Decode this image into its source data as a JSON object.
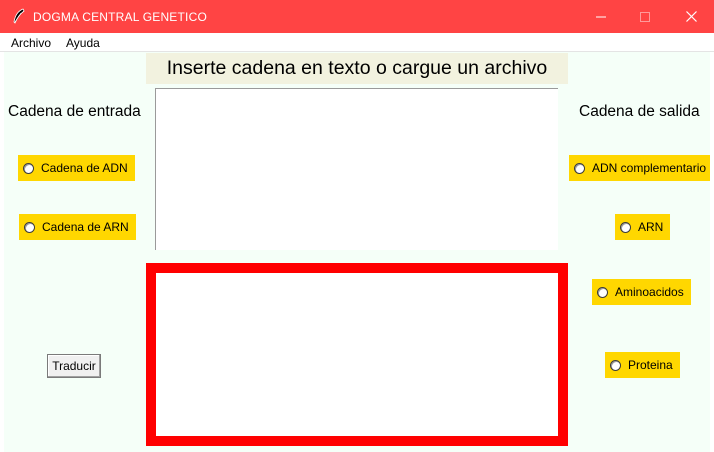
{
  "window": {
    "title": "DOGMA CENTRAL GENETICO",
    "titlebar_color": "#ff4444"
  },
  "menubar": {
    "items": [
      {
        "label": "Archivo"
      },
      {
        "label": "Ayuda"
      }
    ]
  },
  "main": {
    "prompt_label": "Inserte cadena en texto o cargue un archivo",
    "input_section_label": "Cadena de entrada",
    "output_section_label": "Cadena de salida",
    "input_text": "",
    "output_text": "",
    "translate_button_label": "Traducir",
    "input_options": [
      {
        "label": "Cadena de ADN",
        "selected": false
      },
      {
        "label": "Cadena de ARN",
        "selected": false
      }
    ],
    "output_options": [
      {
        "label": "ADN complementario",
        "selected": false
      },
      {
        "label": "ARN",
        "selected": false
      },
      {
        "label": "Aminoacidos",
        "selected": false
      },
      {
        "label": "Proteina",
        "selected": false
      }
    ]
  },
  "colors": {
    "accent_yellow": "#ffd700",
    "output_border": "#ff0000",
    "background": "#f5fff8",
    "prompt_background": "#f2f2df"
  },
  "icons": {
    "app": "feather-icon",
    "minimize": "minimize-icon",
    "maximize": "maximize-icon",
    "close": "close-icon"
  }
}
